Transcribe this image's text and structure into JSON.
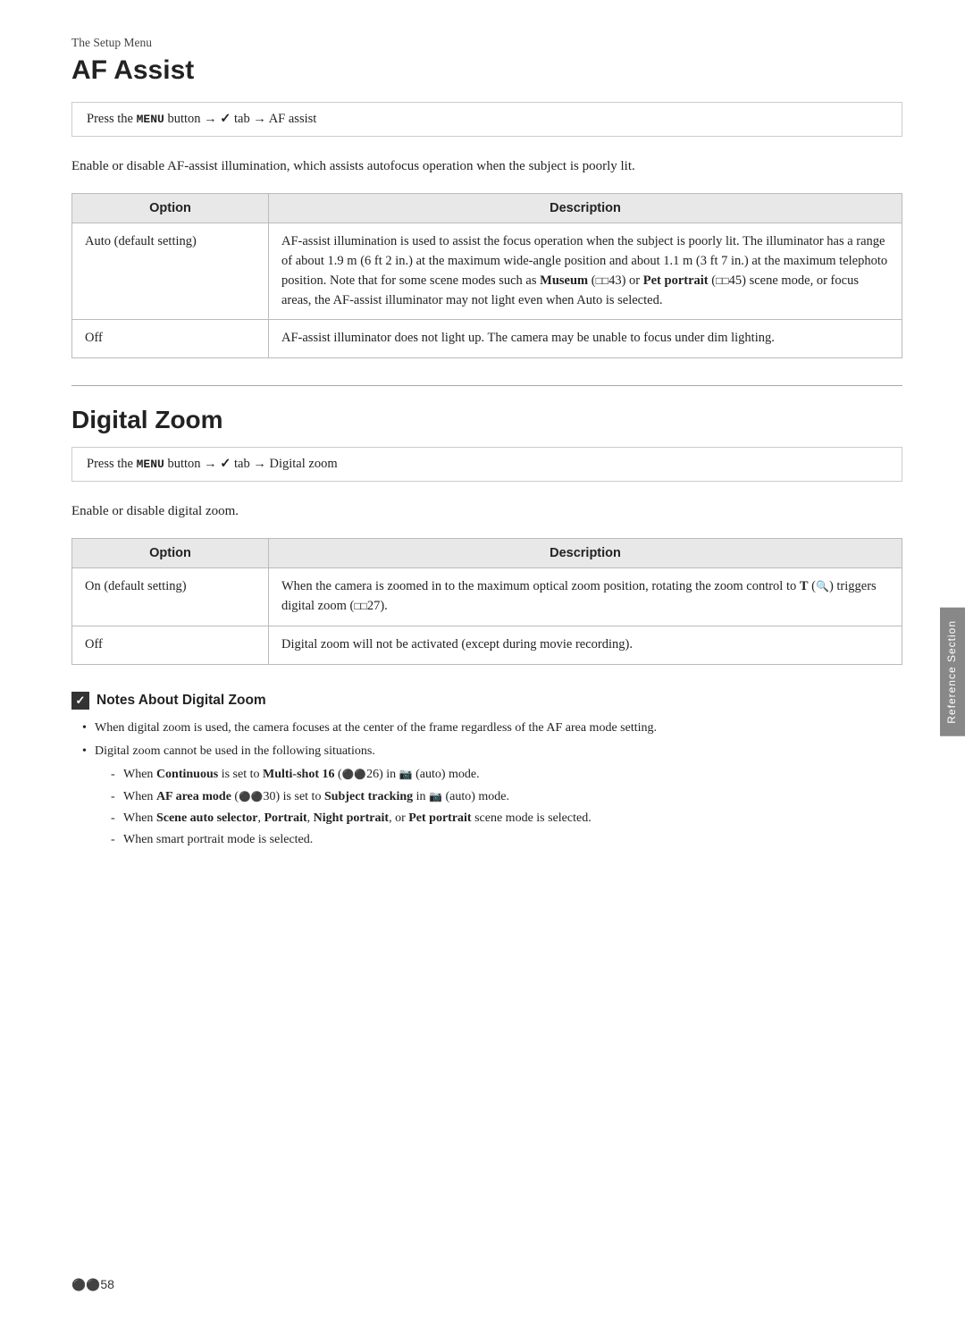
{
  "breadcrumb": "The Setup Menu",
  "section1": {
    "title": "AF Assist",
    "nav": {
      "prefix": "Press the ",
      "menu_word": "MENU",
      "middle1": " button → ",
      "tab_icon": "Y",
      "middle2": " tab → ",
      "destination": "AF assist"
    },
    "intro": "Enable or disable AF-assist illumination, which assists autofocus operation when the subject is poorly lit.",
    "table": {
      "col1": "Option",
      "col2": "Description",
      "rows": [
        {
          "option": "Auto (default setting)",
          "description_parts": [
            {
              "type": "text",
              "content": "AF-assist illumination is used to assist the focus operation when the subject is poorly lit. The illuminator has a range of about 1.9 m (6 ft 2 in.) at the maximum wide-angle position and about 1.1 m (3 ft 7 in.) at the maximum telephoto position. Note that for some scene modes such as "
            },
            {
              "type": "bold",
              "content": "Museum"
            },
            {
              "type": "text",
              "content": " ("
            },
            {
              "type": "mono",
              "content": "□□"
            },
            {
              "type": "text",
              "content": "43) or "
            },
            {
              "type": "bold",
              "content": "Pet portrait"
            },
            {
              "type": "text",
              "content": " ("
            },
            {
              "type": "mono",
              "content": "□□"
            },
            {
              "type": "text",
              "content": "45) scene mode, or focus areas, the AF-assist illuminator may not light even when Auto is selected."
            }
          ]
        },
        {
          "option": "Off",
          "description": "AF-assist illuminator does not light up. The camera may be unable to focus under dim lighting."
        }
      ]
    }
  },
  "section2": {
    "title": "Digital Zoom",
    "nav": {
      "prefix": "Press the ",
      "menu_word": "MENU",
      "middle1": " button → ",
      "tab_icon": "Y",
      "middle2": " tab → ",
      "destination": "Digital zoom"
    },
    "intro": "Enable or disable digital zoom.",
    "table": {
      "col1": "Option",
      "col2": "Description",
      "rows": [
        {
          "option": "On (default setting)",
          "description_parts": [
            {
              "type": "text",
              "content": "When the camera is zoomed in to the maximum optical zoom position, rotating the zoom control to "
            },
            {
              "type": "bold",
              "content": "T"
            },
            {
              "type": "text",
              "content": " ("
            },
            {
              "type": "symbol",
              "content": "Q"
            },
            {
              "type": "text",
              "content": ") triggers digital zoom ("
            },
            {
              "type": "mono",
              "content": "□□"
            },
            {
              "type": "text",
              "content": "27)."
            }
          ]
        },
        {
          "option": "Off",
          "description": "Digital zoom will not be activated (except during movie recording)."
        }
      ]
    }
  },
  "notes": {
    "title": "Notes About Digital Zoom",
    "items": [
      "When digital zoom is used, the camera focuses at the center of the frame regardless of the AF area mode setting.",
      "Digital zoom cannot be used in the following situations.",
      null
    ],
    "subitems": [
      {
        "parts": [
          {
            "type": "text",
            "content": "When "
          },
          {
            "type": "bold",
            "content": "Continuous"
          },
          {
            "type": "text",
            "content": " is set to "
          },
          {
            "type": "bold",
            "content": "Multi-shot 16"
          },
          {
            "type": "text",
            "content": " ("
          },
          {
            "type": "symbol",
            "content": "⚙"
          },
          {
            "type": "text",
            "content": "26) in "
          },
          {
            "type": "symbol2",
            "content": "▣"
          },
          {
            "type": "text",
            "content": " (auto) mode."
          }
        ]
      },
      {
        "parts": [
          {
            "type": "text",
            "content": "When "
          },
          {
            "type": "bold",
            "content": "AF area mode"
          },
          {
            "type": "text",
            "content": " ("
          },
          {
            "type": "symbol",
            "content": "⚙"
          },
          {
            "type": "text",
            "content": "30) is set to "
          },
          {
            "type": "bold",
            "content": "Subject tracking"
          },
          {
            "type": "text",
            "content": " in "
          },
          {
            "type": "symbol2",
            "content": "▣"
          },
          {
            "type": "text",
            "content": " (auto) mode."
          }
        ]
      },
      {
        "parts": [
          {
            "type": "text",
            "content": "When "
          },
          {
            "type": "bold",
            "content": "Scene auto selector"
          },
          {
            "type": "text",
            "content": ", "
          },
          {
            "type": "bold",
            "content": "Portrait"
          },
          {
            "type": "text",
            "content": ", "
          },
          {
            "type": "bold",
            "content": "Night portrait"
          },
          {
            "type": "text",
            "content": ", or "
          },
          {
            "type": "bold",
            "content": "Pet portrait"
          },
          {
            "type": "text",
            "content": " scene mode is selected."
          }
        ]
      },
      {
        "parts": [
          {
            "type": "text",
            "content": "When smart portrait mode is selected."
          }
        ]
      }
    ]
  },
  "footer": {
    "page_number": "58",
    "icon": "⚙"
  },
  "side_tab": {
    "label": "Reference Section"
  }
}
